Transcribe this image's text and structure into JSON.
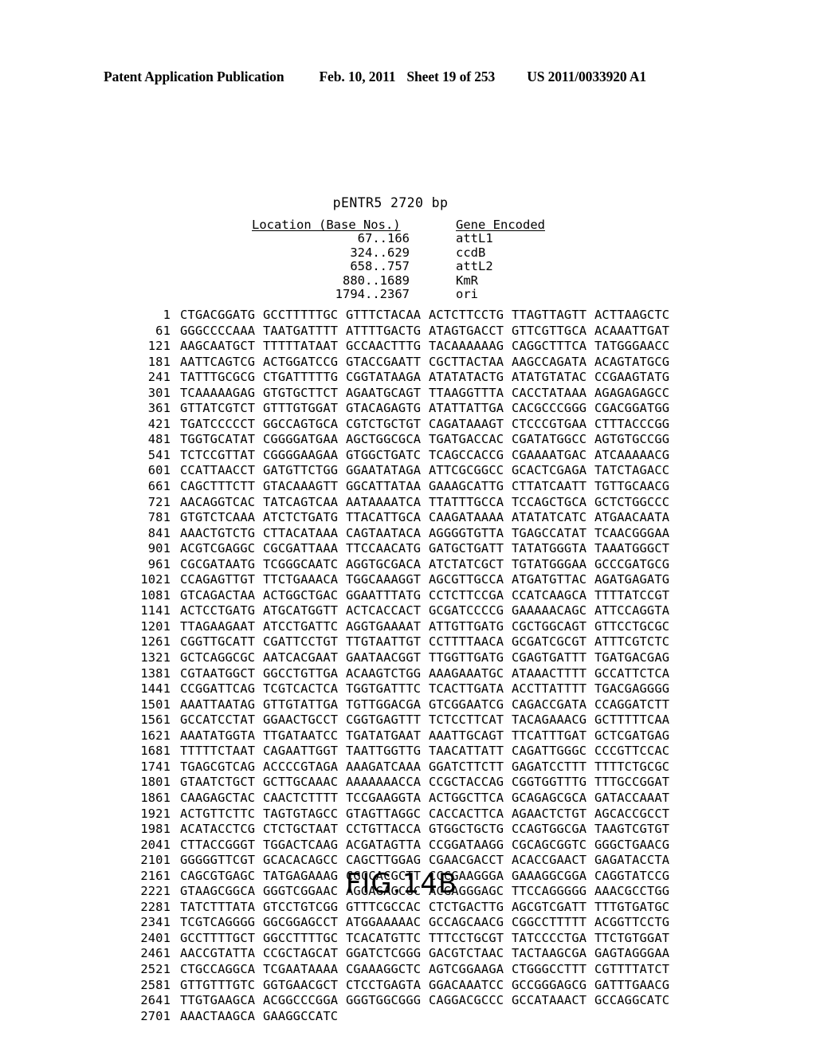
{
  "header": {
    "publication": "Patent Application Publication",
    "date": "Feb. 10, 2011",
    "sheet": "Sheet 19 of 253",
    "number": "US 2011/0033920 A1"
  },
  "figure": {
    "caption": "FIG.14B",
    "plasmid_title": "pENTR5 2720 bp",
    "table": {
      "headers": {
        "location": "Location (Base Nos.)",
        "gene": "Gene Encoded"
      },
      "rows": [
        {
          "location": "67..166",
          "gene": "attL1"
        },
        {
          "location": "324..629",
          "gene": "ccdB"
        },
        {
          "location": "658..757",
          "gene": "attL2"
        },
        {
          "location": "880..1689",
          "gene": "KmR"
        },
        {
          "location": "1794..2367",
          "gene": "ori"
        }
      ]
    },
    "sequence": {
      "line_length": 60,
      "chunk_size": 10,
      "rows": [
        {
          "index": "1",
          "chunks": [
            "CTGACGGATG",
            "GCCTTTTTGC",
            "GTTTCTACAA",
            "ACTCTTCCTG",
            "TTAGTTAGTT",
            "ACTTAAGCTC"
          ]
        },
        {
          "index": "61",
          "chunks": [
            "GGGCCCCAAA",
            "TAATGATTTT",
            "ATTTTGACTG",
            "ATAGTGACCT",
            "GTTCGTTGCA",
            "ACAAATTGAT"
          ]
        },
        {
          "index": "121",
          "chunks": [
            "AAGCAATGCT",
            "TTTTTATAAT",
            "GCCAACTTTG",
            "TACAAAAAAG",
            "CAGGCTTTCA",
            "TATGGGAACC"
          ]
        },
        {
          "index": "181",
          "chunks": [
            "AATTCAGTCG",
            "ACTGGATCCG",
            "GTACCGAATT",
            "CGCTTACTAA",
            "AAGCCAGATA",
            "ACAGTATGCG"
          ]
        },
        {
          "index": "241",
          "chunks": [
            "TATTTGCGCG",
            "CTGATTTTTG",
            "CGGTATAAGA",
            "ATATATACTG",
            "ATATGTATAC",
            "CCGAAGTATG"
          ]
        },
        {
          "index": "301",
          "chunks": [
            "TCAAAAAGAG",
            "GTGTGCTTCT",
            "AGAATGCAGT",
            "TTAAGGTTTA",
            "CACCTATAAA",
            "AGAGAGAGCC"
          ]
        },
        {
          "index": "361",
          "chunks": [
            "GTTATCGTCT",
            "GTTTGTGGAT",
            "GTACAGAGTG",
            "ATATTATTGA",
            "CACGCCCGGG",
            "CGACGGATGG"
          ]
        },
        {
          "index": "421",
          "chunks": [
            "TGATCCCCCT",
            "GGCCAGTGCA",
            "CGTCTGCTGT",
            "CAGATAAAGT",
            "CTCCCGTGAA",
            "CTTTACCCGG"
          ]
        },
        {
          "index": "481",
          "chunks": [
            "TGGTGCATAT",
            "CGGGGATGAA",
            "AGCTGGCGCA",
            "TGATGACCAC",
            "CGATATGGCC",
            "AGTGTGCCGG"
          ]
        },
        {
          "index": "541",
          "chunks": [
            "TCTCCGTTAT",
            "CGGGGAAGAA",
            "GTGGCTGATC",
            "TCAGCCACCG",
            "CGAAAATGAC",
            "ATCAAAAACG"
          ]
        },
        {
          "index": "601",
          "chunks": [
            "CCATTAACCT",
            "GATGTTCTGG",
            "GGAATATAGA",
            "ATTCGCGGCC",
            "GCACTCGAGA",
            "TATCTAGACC"
          ]
        },
        {
          "index": "661",
          "chunks": [
            "CAGCTTTCTT",
            "GTACAAAGTT",
            "GGCATTATAA",
            "GAAAGCATTG",
            "CTTATCAATT",
            "TGTTGCAACG"
          ]
        },
        {
          "index": "721",
          "chunks": [
            "AACAGGTCAC",
            "TATCAGTCAA",
            "AATAAAATCA",
            "TTATTTGCCA",
            "TCCAGCTGCA",
            "GCTCTGGCCC"
          ]
        },
        {
          "index": "781",
          "chunks": [
            "GTGTCTCAAA",
            "ATCTCTGATG",
            "TTACATTGCA",
            "CAAGATAAAA",
            "ATATATCATC",
            "ATGAACAATA"
          ]
        },
        {
          "index": "841",
          "chunks": [
            "AAACTGTCTG",
            "CTTACATAAA",
            "CAGTAATACA",
            "AGGGGTGTTA",
            "TGAGCCATAT",
            "TCAACGGGAA"
          ]
        },
        {
          "index": "901",
          "chunks": [
            "ACGTCGAGGC",
            "CGCGATTAAA",
            "TTCCAACATG",
            "GATGCTGATT",
            "TATATGGGTA",
            "TAAATGGGCT"
          ]
        },
        {
          "index": "961",
          "chunks": [
            "CGCGATAATG",
            "TCGGGCAATC",
            "AGGTGCGACA",
            "ATCTATCGCT",
            "TGTATGGGAA",
            "GCCCGATGCG"
          ]
        },
        {
          "index": "1021",
          "chunks": [
            "CCAGAGTTGT",
            "TTCTGAAACA",
            "TGGCAAAGGT",
            "AGCGTTGCCA",
            "ATGATGTTAC",
            "AGATGAGATG"
          ]
        },
        {
          "index": "1081",
          "chunks": [
            "GTCAGACTAA",
            "ACTGGCTGAC",
            "GGAATTTATG",
            "CCTCTTCCGA",
            "CCATCAAGCA",
            "TTTTATCCGT"
          ]
        },
        {
          "index": "1141",
          "chunks": [
            "ACTCCTGATG",
            "ATGCATGGTT",
            "ACTCACCACT",
            "GCGATCCCCG",
            "GAAAAACAGC",
            "ATTCCAGGTA"
          ]
        },
        {
          "index": "1201",
          "chunks": [
            "TTAGAAGAAT",
            "ATCCTGATTC",
            "AGGTGAAAAT",
            "ATTGTTGATG",
            "CGCTGGCAGT",
            "GTTCCTGCGC"
          ]
        },
        {
          "index": "1261",
          "chunks": [
            "CGGTTGCATT",
            "CGATTCCTGT",
            "TTGTAATTGT",
            "CCTTTTAACA",
            "GCGATCGCGT",
            "ATTTCGTCTC"
          ]
        },
        {
          "index": "1321",
          "chunks": [
            "GCTCAGGCGC",
            "AATCACGAAT",
            "GAATAACGGT",
            "TTGGTTGATG",
            "CGAGTGATTT",
            "TGATGACGAG"
          ]
        },
        {
          "index": "1381",
          "chunks": [
            "CGTAATGGCT",
            "GGCCTGTTGA",
            "ACAAGTCTGG",
            "AAAGAAATGC",
            "ATAAACTTTT",
            "GCCATTCTCA"
          ]
        },
        {
          "index": "1441",
          "chunks": [
            "CCGGATTCAG",
            "TCGTCACTCA",
            "TGGTGATTTC",
            "TCACTTGATA",
            "ACCTTATTTT",
            "TGACGAGGGG"
          ]
        },
        {
          "index": "1501",
          "chunks": [
            "AAATTAATAG",
            "GTTGTATTGA",
            "TGTTGGACGA",
            "GTCGGAATCG",
            "CAGACCGATA",
            "CCAGGATCTT"
          ]
        },
        {
          "index": "1561",
          "chunks": [
            "GCCATCCTAT",
            "GGAACTGCCT",
            "CGGTGAGTTT",
            "TCTCCTTCAT",
            "TACAGAAACG",
            "GCTTTTTCAA"
          ]
        },
        {
          "index": "1621",
          "chunks": [
            "AAATATGGTA",
            "TTGATAATCC",
            "TGATATGAAT",
            "AAATTGCAGT",
            "TTCATTTGAT",
            "GCTCGATGAG"
          ]
        },
        {
          "index": "1681",
          "chunks": [
            "TTTTTCTAAT",
            "CAGAATTGGT",
            "TAATTGGTTG",
            "TAACATTATT",
            "CAGATTGGGC",
            "CCCGTTCCAC"
          ]
        },
        {
          "index": "1741",
          "chunks": [
            "TGAGCGTCAG",
            "ACCCCGTAGA",
            "AAAGATCAAA",
            "GGATCTTCTT",
            "GAGATCCTTT",
            "TTTTCTGCGC"
          ]
        },
        {
          "index": "1801",
          "chunks": [
            "GTAATCTGCT",
            "GCTTGCAAAC",
            "AAAAAAACCA",
            "CCGCTACCAG",
            "CGGTGGTTTG",
            "TTTGCCGGAT"
          ]
        },
        {
          "index": "1861",
          "chunks": [
            "CAAGAGCTAC",
            "CAACTCTTTT",
            "TCCGAAGGTA",
            "ACTGGCTTCA",
            "GCAGAGCGCA",
            "GATACCAAAT"
          ]
        },
        {
          "index": "1921",
          "chunks": [
            "ACTGTTCTTC",
            "TAGTGTAGCC",
            "GTAGTTAGGC",
            "CACCACTTCA",
            "AGAACTCTGT",
            "AGCACCGCCT"
          ]
        },
        {
          "index": "1981",
          "chunks": [
            "ACATACCTCG",
            "CTCTGCTAAT",
            "CCTGTTACCA",
            "GTGGCTGCTG",
            "CCAGTGGCGA",
            "TAAGTCGTGT"
          ]
        },
        {
          "index": "2041",
          "chunks": [
            "CTTACCGGGT",
            "TGGACTCAAG",
            "ACGATAGTTA",
            "CCGGATAAGG",
            "CGCAGCGGTC",
            "GGGCTGAACG"
          ]
        },
        {
          "index": "2101",
          "chunks": [
            "GGGGGTTCGT",
            "GCACACAGCC",
            "CAGCTTGGAG",
            "CGAACGACCT",
            "ACACCGAACT",
            "GAGATACCTA"
          ]
        },
        {
          "index": "2161",
          "chunks": [
            "CAGCGTGAGC",
            "TATGAGAAAG",
            "CGCCACGCTT",
            "CCCGAAGGGA",
            "GAAAGGCGGA",
            "CAGGTATCCG"
          ]
        },
        {
          "index": "2221",
          "chunks": [
            "GTAAGCGGCA",
            "GGGTCGGAAC",
            "AGGAGAGCGC",
            "ACGAGGGAGC",
            "TTCCAGGGGG",
            "AAACGCCTGG"
          ]
        },
        {
          "index": "2281",
          "chunks": [
            "TATCTTTATA",
            "GTCCTGTCGG",
            "GTTTCGCCAC",
            "CTCTGACTTG",
            "AGCGTCGATT",
            "TTTGTGATGC"
          ]
        },
        {
          "index": "2341",
          "chunks": [
            "TCGTCAGGGG",
            "GGCGGAGCCT",
            "ATGGAAAAAC",
            "GCCAGCAACG",
            "CGGCCTTTTT",
            "ACGGTTCCTG"
          ]
        },
        {
          "index": "2401",
          "chunks": [
            "GCCTTTTGCT",
            "GGCCTTTTGC",
            "TCACATGTTC",
            "TTTCCTGCGT",
            "TATCCCCTGA",
            "TTCTGTGGAT"
          ]
        },
        {
          "index": "2461",
          "chunks": [
            "AACCGTATTA",
            "CCGCTAGCAT",
            "GGATCTCGGG",
            "GACGTCTAAC",
            "TACTAAGCGA",
            "GAGTAGGGAA"
          ]
        },
        {
          "index": "2521",
          "chunks": [
            "CTGCCAGGCA",
            "TCGAATAAAA",
            "CGAAAGGCTC",
            "AGTCGGAAGA",
            "CTGGGCCTTT",
            "CGTTTTATCT"
          ]
        },
        {
          "index": "2581",
          "chunks": [
            "GTTGTTTGTC",
            "GGTGAACGCT",
            "CTCCTGAGTA",
            "GGACAAATCC",
            "GCCGGGAGCG",
            "GATTTGAACG"
          ]
        },
        {
          "index": "2641",
          "chunks": [
            "TTGTGAAGCA",
            "ACGGCCCGGA",
            "GGGTGGCGGG",
            "CAGGACGCCC",
            "GCCATAAACT",
            "GCCAGGCATC"
          ]
        },
        {
          "index": "2701",
          "chunks": [
            "AAACTAAGCA",
            "GAAGGCCATC"
          ]
        }
      ]
    }
  }
}
